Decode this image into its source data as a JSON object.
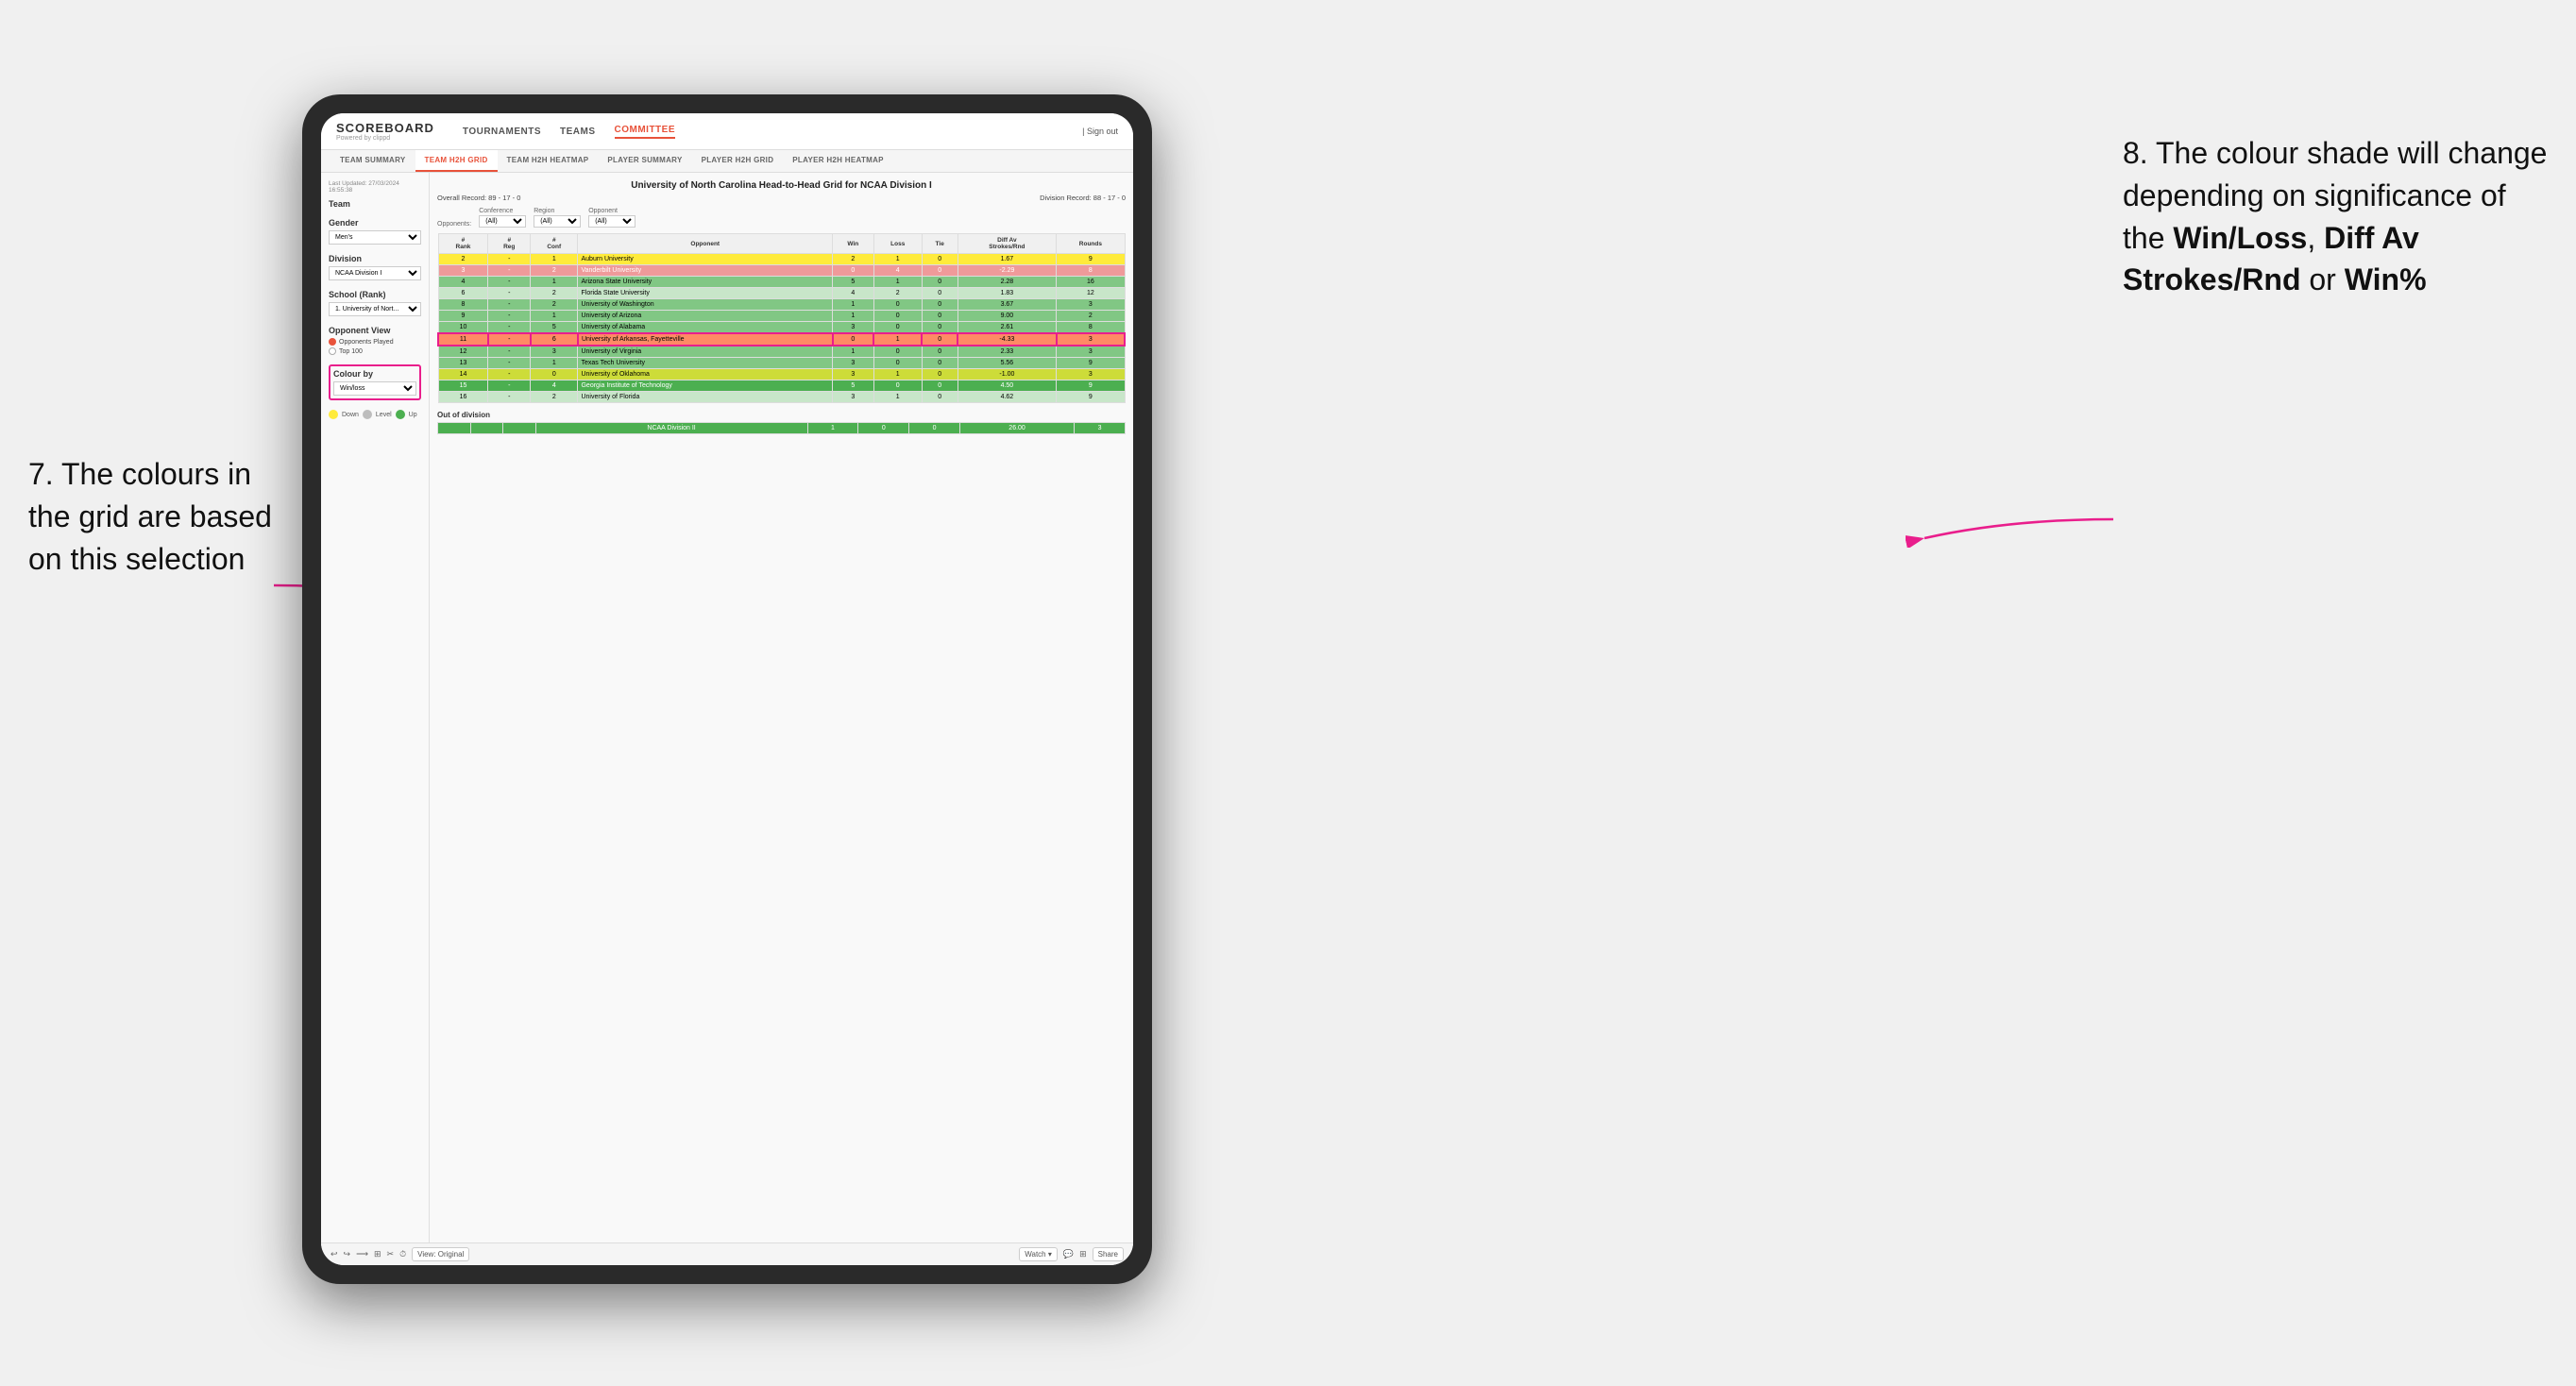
{
  "annotations": {
    "left": "7. The colours in the grid are based on this selection",
    "right_intro": "8. The colour shade will change depending on significance of the ",
    "right_bold1": "Win/Loss",
    "right_sep1": ", ",
    "right_bold2": "Diff Av Strokes/Rnd",
    "right_sep2": " or ",
    "right_bold3": "Win%"
  },
  "nav": {
    "logo": "SCOREBOARD",
    "logo_sub": "Powered by clippd",
    "links": [
      "TOURNAMENTS",
      "TEAMS",
      "COMMITTEE"
    ],
    "active": "COMMITTEE",
    "sign_out": "Sign out"
  },
  "sub_nav": {
    "items": [
      "TEAM SUMMARY",
      "TEAM H2H GRID",
      "TEAM H2H HEATMAP",
      "PLAYER SUMMARY",
      "PLAYER H2H GRID",
      "PLAYER H2H HEATMAP"
    ],
    "active": "TEAM H2H GRID"
  },
  "left_panel": {
    "last_updated_label": "Last Updated: 27/03/2024",
    "last_updated_time": "16:55:38",
    "team_label": "Team",
    "gender_label": "Gender",
    "gender_value": "Men's",
    "division_label": "Division",
    "division_value": "NCAA Division I",
    "school_label": "School (Rank)",
    "school_value": "1. University of Nort...",
    "opponent_view_label": "Opponent View",
    "radio1": "Opponents Played",
    "radio2": "Top 100",
    "colour_by_label": "Colour by",
    "colour_by_value": "Win/loss",
    "legend": {
      "down_label": "Down",
      "level_label": "Level",
      "up_label": "Up"
    }
  },
  "grid": {
    "title": "University of North Carolina Head-to-Head Grid for NCAA Division I",
    "overall_record": "Overall Record: 89 - 17 - 0",
    "division_record": "Division Record: 88 - 17 - 0",
    "filters": {
      "opponents_label": "Opponents:",
      "conference_label": "Conference",
      "conference_value": "(All)",
      "region_label": "Region",
      "region_value": "(All)",
      "opponent_label": "Opponent",
      "opponent_value": "(All)"
    },
    "columns": [
      "#\nRank",
      "#\nReg",
      "#\nConf",
      "Opponent",
      "Win",
      "Loss",
      "Tie",
      "Diff Av\nStrokes/Rnd",
      "Rounds"
    ],
    "rows": [
      {
        "rank": "2",
        "reg": "-",
        "conf": "1",
        "opponent": "Auburn University",
        "win": "2",
        "loss": "1",
        "tie": "0",
        "diff": "1.67",
        "rounds": "9",
        "color": "yellow"
      },
      {
        "rank": "3",
        "reg": "-",
        "conf": "2",
        "opponent": "Vanderbilt University",
        "win": "0",
        "loss": "4",
        "tie": "0",
        "diff": "-2.29",
        "rounds": "8",
        "color": "red"
      },
      {
        "rank": "4",
        "reg": "-",
        "conf": "1",
        "opponent": "Arizona State University",
        "win": "5",
        "loss": "1",
        "tie": "0",
        "diff": "2.28",
        "rounds": "16",
        "color": "green"
      },
      {
        "rank": "6",
        "reg": "-",
        "conf": "2",
        "opponent": "Florida State University",
        "win": "4",
        "loss": "2",
        "tie": "0",
        "diff": "1.83",
        "rounds": "12",
        "color": "light-green"
      },
      {
        "rank": "8",
        "reg": "-",
        "conf": "2",
        "opponent": "University of Washington",
        "win": "1",
        "loss": "0",
        "tie": "0",
        "diff": "3.67",
        "rounds": "3",
        "color": "green"
      },
      {
        "rank": "9",
        "reg": "-",
        "conf": "1",
        "opponent": "University of Arizona",
        "win": "1",
        "loss": "0",
        "tie": "0",
        "diff": "9.00",
        "rounds": "2",
        "color": "green"
      },
      {
        "rank": "10",
        "reg": "-",
        "conf": "5",
        "opponent": "University of Alabama",
        "win": "3",
        "loss": "0",
        "tie": "0",
        "diff": "2.61",
        "rounds": "8",
        "color": "green"
      },
      {
        "rank": "11",
        "reg": "-",
        "conf": "6",
        "opponent": "University of Arkansas, Fayetteville",
        "win": "0",
        "loss": "1",
        "tie": "0",
        "diff": "-4.33",
        "rounds": "3",
        "color": "orange-red"
      },
      {
        "rank": "12",
        "reg": "-",
        "conf": "3",
        "opponent": "University of Virginia",
        "win": "1",
        "loss": "0",
        "tie": "0",
        "diff": "2.33",
        "rounds": "3",
        "color": "green"
      },
      {
        "rank": "13",
        "reg": "-",
        "conf": "1",
        "opponent": "Texas Tech University",
        "win": "3",
        "loss": "0",
        "tie": "0",
        "diff": "5.56",
        "rounds": "9",
        "color": "green"
      },
      {
        "rank": "14",
        "reg": "-",
        "conf": "0",
        "opponent": "University of Oklahoma",
        "win": "3",
        "loss": "1",
        "tie": "0",
        "diff": "-1.00",
        "rounds": "3",
        "color": "yellow-green"
      },
      {
        "rank": "15",
        "reg": "-",
        "conf": "4",
        "opponent": "Georgia Institute of Technology",
        "win": "5",
        "loss": "0",
        "tie": "0",
        "diff": "4.50",
        "rounds": "9",
        "color": "dark-green"
      },
      {
        "rank": "16",
        "reg": "-",
        "conf": "2",
        "opponent": "University of Florida",
        "win": "3",
        "loss": "1",
        "tie": "0",
        "diff": "4.62",
        "rounds": "9",
        "color": "light-green"
      }
    ],
    "out_of_division_label": "Out of division",
    "out_of_division_row": {
      "name": "NCAA Division II",
      "win": "1",
      "loss": "0",
      "tie": "0",
      "diff": "26.00",
      "rounds": "3",
      "color": "dark-green"
    }
  },
  "toolbar": {
    "view_label": "View: Original",
    "watch_label": "Watch ▾",
    "share_label": "Share"
  }
}
